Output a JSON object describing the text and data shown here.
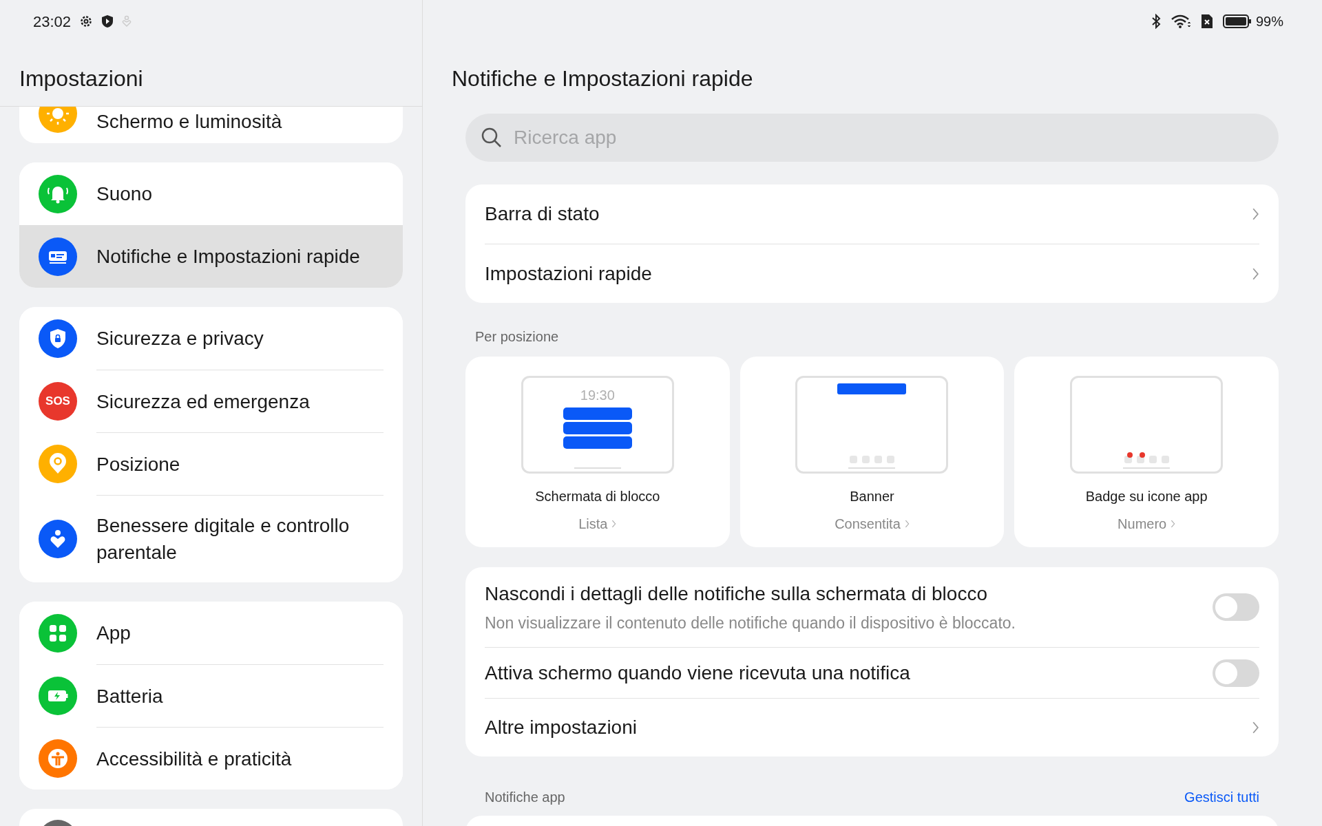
{
  "status_bar": {
    "time": "23:02",
    "battery": "99%"
  },
  "sidebar": {
    "title": "Impostazioni",
    "groups": [
      {
        "items": [
          {
            "label": "Schermo e luminosità",
            "selected": false
          }
        ]
      },
      {
        "items": [
          {
            "label": "Suono",
            "selected": false
          },
          {
            "label": "Notifiche e Impostazioni rapide",
            "selected": true
          }
        ]
      },
      {
        "items": [
          {
            "label": "Sicurezza e privacy",
            "selected": false
          },
          {
            "label": "Sicurezza ed emergenza",
            "badge": "SOS",
            "selected": false
          },
          {
            "label": "Posizione",
            "selected": false
          },
          {
            "label": "Benessere digitale e controllo parentale",
            "selected": false
          }
        ]
      },
      {
        "items": [
          {
            "label": "App",
            "selected": false
          },
          {
            "label": "Batteria",
            "selected": false
          },
          {
            "label": "Accessibilità e praticità",
            "selected": false
          }
        ]
      }
    ]
  },
  "main": {
    "title": "Notifiche e Impostazioni rapide",
    "search": {
      "placeholder": "Ricerca app"
    },
    "links": [
      {
        "label": "Barra di stato"
      },
      {
        "label": "Impostazioni rapide"
      }
    ],
    "section_label": "Per posizione",
    "styles": [
      {
        "kind": "lock",
        "preview_time": "19:30",
        "title": "Schermata di blocco",
        "value": "Lista"
      },
      {
        "kind": "banner",
        "title": "Banner",
        "value": "Consentita"
      },
      {
        "kind": "badge",
        "title": "Badge su icone app",
        "value": "Numero"
      }
    ],
    "options": [
      {
        "kind": "toggle",
        "label": "Nascondi i dettagli delle notifiche sulla schermata di blocco",
        "description": "Non visualizzare il contenuto delle notifiche quando il dispositivo è bloccato.",
        "on": false
      },
      {
        "kind": "toggle",
        "label": "Attiva schermo quando viene ricevuta una notifica",
        "on": false
      },
      {
        "kind": "link",
        "label": "Altre impostazioni"
      }
    ],
    "app_section": {
      "label": "Notifiche app",
      "action": "Gestisci tutti"
    }
  }
}
